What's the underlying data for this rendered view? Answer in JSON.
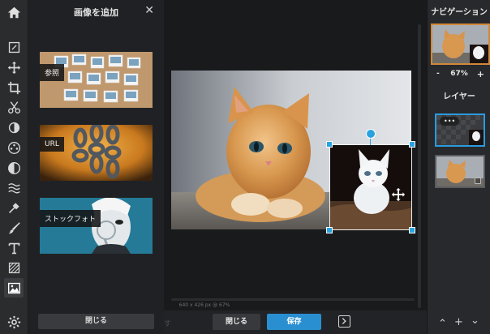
{
  "toolbar": {
    "items": [
      {
        "name": "home-icon",
        "icon": "home"
      },
      {
        "name": "crop-ratio-icon",
        "icon": "document-edit"
      },
      {
        "name": "move-icon",
        "icon": "arrows"
      },
      {
        "name": "crop-icon",
        "icon": "crop"
      },
      {
        "name": "cut-icon",
        "icon": "scissors"
      },
      {
        "name": "adjust-icon",
        "icon": "half-sun"
      },
      {
        "name": "effects-icon",
        "icon": "film-reel"
      },
      {
        "name": "vignette-icon",
        "icon": "half-circle"
      },
      {
        "name": "wave-icon",
        "icon": "waves"
      },
      {
        "name": "dropper-icon",
        "icon": "eyedropper"
      },
      {
        "name": "brush-icon",
        "icon": "brush"
      },
      {
        "name": "text-icon",
        "icon": "T"
      },
      {
        "name": "texture-icon",
        "icon": "hatched-square"
      },
      {
        "name": "image-icon",
        "icon": "picture",
        "active": true
      },
      {
        "name": "settings-icon",
        "icon": "gear"
      }
    ]
  },
  "panel": {
    "title": "画像を追加",
    "close_glyph": "✕",
    "sources": [
      {
        "label": "参照"
      },
      {
        "label": "URL"
      },
      {
        "label": "ストックフォト"
      }
    ],
    "close_button": "閉じる"
  },
  "canvas": {
    "dimensions_text": "640 x 426 px @ 67%"
  },
  "bottom": {
    "ghost_text": "す",
    "close_label": "閉じる",
    "save_label": "保存"
  },
  "navigation": {
    "title": "ナビゲーション",
    "zoom_minus": "-",
    "zoom_value": "67%",
    "zoom_plus": "+"
  },
  "layers": {
    "title": "レイヤー",
    "dots": "•••"
  },
  "colors": {
    "accent": "#2a8fd1",
    "nav_border": "#d0893a"
  }
}
